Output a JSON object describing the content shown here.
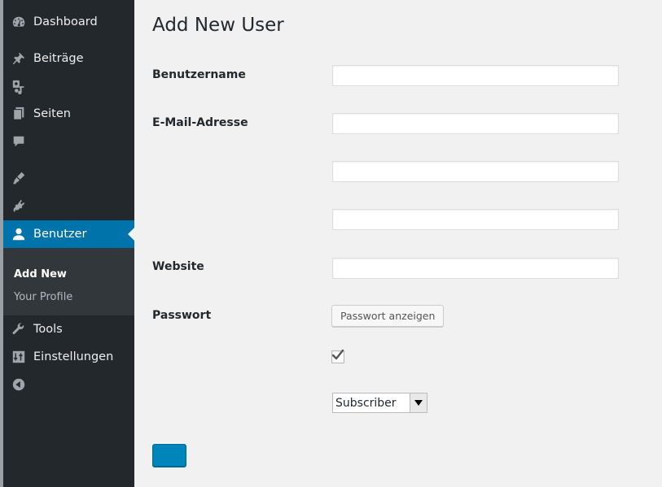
{
  "sidebar": {
    "items": [
      {
        "label": "Dashboard",
        "icon": "dashboard-icon"
      },
      {
        "label": "Beiträge",
        "icon": "pushpin-icon"
      },
      {
        "label": "",
        "icon": "media-icon"
      },
      {
        "label": "Seiten",
        "icon": "pages-icon"
      },
      {
        "label": "",
        "icon": "comment-icon"
      },
      {
        "label": "",
        "icon": "appearance-brush-icon"
      },
      {
        "label": "",
        "icon": "plugin-icon"
      },
      {
        "label": "Benutzer",
        "icon": "user-icon"
      },
      {
        "label": "Tools",
        "icon": "wrench-icon"
      },
      {
        "label": "Einstellungen",
        "icon": "settings-sliders-icon"
      },
      {
        "label": "",
        "icon": "collapse-arrow-icon"
      }
    ],
    "submenu": {
      "current": "Add New",
      "other": "Your Profile"
    }
  },
  "main": {
    "title": "Add New User",
    "fields": {
      "username_label": "Benutzername",
      "email_label": "E-Mail-Adresse",
      "website_label": "Website",
      "password_label": "Passwort"
    },
    "show_password_button": "Passwort anzeigen",
    "role_select": {
      "value": "Subscriber"
    },
    "colors": {
      "sidebar_bg": "#23282d",
      "active": "#0073aa",
      "primary_button": "#0085ba"
    }
  }
}
